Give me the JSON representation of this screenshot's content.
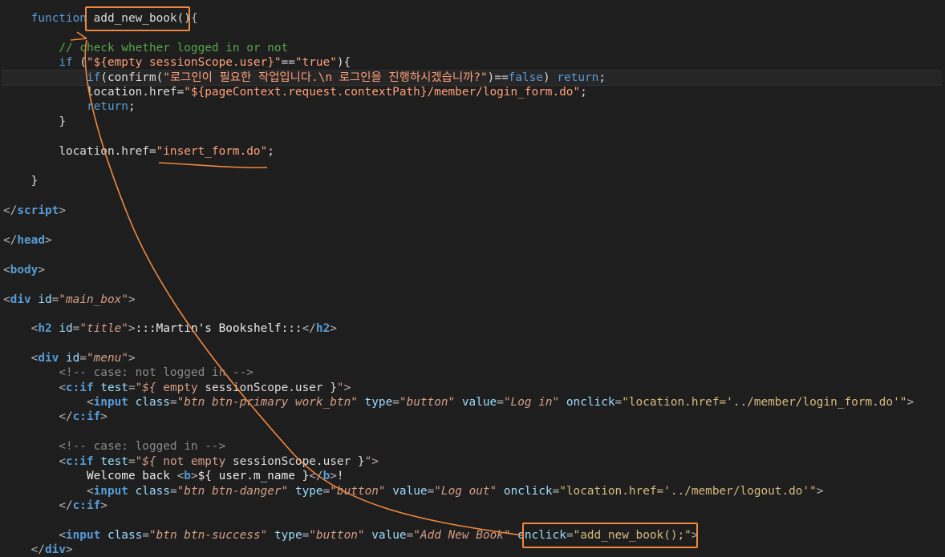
{
  "code": {
    "indent": "    ",
    "l01": {
      "kw": "function",
      "name": " add_new_book()",
      "rest": "{"
    },
    "l02": {
      "cm": "// check whether logged in or not"
    },
    "l03": {
      "kw": "if",
      "pre": " (",
      "str": "\"${empty sessionScope.user}\"",
      "op": "==",
      "str2": "\"true\"",
      "rest": "){"
    },
    "l04": {
      "kw": "if",
      "a": "(confirm(",
      "str": "\"로그인이 필요한 작업입니다.\\n 로그인을 진행하시겠습니까?\"",
      "b": ")==",
      "kw2": "false",
      "c": ") ",
      "kw3": "return",
      "d": ";"
    },
    "l05": {
      "a": "location.href=",
      "str": "\"${pageContext.request.contextPath}/member/login_form.do\"",
      "b": ";"
    },
    "l06": {
      "kw": "return",
      "a": ";"
    },
    "l07": {
      "a": "}"
    },
    "l08": {
      "a": "location.href=",
      "str": "\"insert_form.do\"",
      "b": ";"
    },
    "l09": {
      "a": "}"
    },
    "l10": {
      "open": "</",
      "tag": "script",
      "close": ">"
    },
    "l11": {
      "open": "</",
      "tag": "head",
      "close": ">"
    },
    "l12": {
      "open": "<",
      "tag": "body",
      "close": ">"
    },
    "l13": {
      "open": "<",
      "tag": "div",
      "sp": " ",
      "attr": "id",
      "eq": "=",
      "val": "\"main_box\"",
      "close": ">"
    },
    "l14": {
      "open": "<",
      "tag": "h2",
      "sp": " ",
      "attr": "id",
      "eq": "=",
      "val": "\"title\"",
      "close": ">",
      "text": ":::Martin's Bookshelf:::",
      "eopen": "</",
      "etag": "h2",
      "eclose": ">"
    },
    "l15": {
      "open": "<",
      "tag": "div",
      "sp": " ",
      "attr": "id",
      "eq": "=",
      "val": "\"menu\"",
      "close": ">"
    },
    "l16": {
      "cm": "<!-- case: not logged in -->"
    },
    "l17": {
      "open": "<",
      "tag": "c:if",
      "sp": " ",
      "attr": "test",
      "eq": "=",
      "q1": "\"${ ",
      "kw": "empty",
      "expr": " sessionScope.user }",
      "q2": "\"",
      "close": ">"
    },
    "l18": {
      "open": "<",
      "tag": "input",
      "a1": "class",
      "v1": "\"btn btn-primary work_btn\"",
      "a2": "type",
      "v2": "\"button\"",
      "a3": "value",
      "v3": "\"Log in\"",
      "a4": "onclick",
      "v4": "\"location.href='../member/login_form.do'\"",
      "close": ">"
    },
    "l19": {
      "open": "</",
      "tag": "c:if",
      "close": ">"
    },
    "l20": {
      "cm": "<!-- case: logged in -->"
    },
    "l21": {
      "open": "<",
      "tag": "c:if",
      "sp": " ",
      "attr": "test",
      "eq": "=",
      "q1": "\"${ ",
      "kw": "not empty",
      "expr": " sessionScope.user }",
      "q2": "\"",
      "close": ">"
    },
    "l22": {
      "a": "Welcome back ",
      "open": "<",
      "tag": "b",
      "close": ">",
      "expr": "${ user.m_name }",
      "eopen": "</",
      "etag": "b",
      "eclose": ">",
      "b": "!"
    },
    "l23": {
      "open": "<",
      "tag": "input",
      "a1": "class",
      "v1": "\"btn btn-danger\"",
      "a2": "type",
      "v2": "\"button\"",
      "a3": "value",
      "v3": "\"Log out\"",
      "a4": "onclick",
      "v4": "\"location.href='../member/logout.do'\"",
      "close": ">"
    },
    "l24": {
      "open": "</",
      "tag": "c:if",
      "close": ">"
    },
    "l25": {
      "open": "<",
      "tag": "input",
      "a1": "class",
      "v1": "\"btn btn-success\"",
      "a2": "type",
      "v2": "\"button\"",
      "a3": "value",
      "v3": "\"Add New Book\"",
      "a4": "onclick",
      "v4": "\"add_new_book();\"",
      "close": ">"
    },
    "l26": {
      "open": "</",
      "tag": "div",
      "close": ">"
    }
  },
  "colors": {
    "background": "#1e1e1e",
    "annotation": "#f0883e"
  }
}
